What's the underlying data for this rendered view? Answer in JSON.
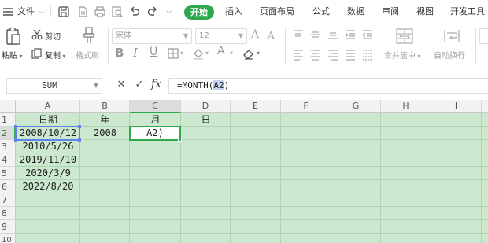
{
  "menu": {
    "file_label": "文件",
    "tabs": [
      "开始",
      "插入",
      "页面布局",
      "公式",
      "数据",
      "审阅",
      "视图",
      "开发工具"
    ],
    "active_tab": "开始"
  },
  "ribbon": {
    "paste_label": "粘贴",
    "cut_label": "剪切",
    "copy_label": "复制",
    "format_painter_label": "格式刷",
    "font_name": "宋体",
    "font_size": "12",
    "bold_label": "B",
    "italic_label": "I",
    "underline_label": "U",
    "merge_center_label": "合并居中",
    "auto_wrap_label": "自动换行"
  },
  "formula_bar": {
    "name_box": "SUM",
    "formula_prefix": "=MONTH(",
    "formula_ref": "A2",
    "formula_suffix": ")",
    "fx_label": "fx"
  },
  "sheet": {
    "columns": [
      "A",
      "B",
      "C",
      "D",
      "E",
      "F",
      "G",
      "H",
      "I"
    ],
    "rows": [
      "1",
      "2",
      "3",
      "4",
      "5",
      "6",
      "7",
      "8",
      "9",
      "10"
    ],
    "selected_column": "C",
    "selected_row": "2",
    "header_row": [
      "日期",
      "年",
      "月",
      "日"
    ],
    "dates": [
      "2008/10/12",
      "2010/5/26",
      "2019/11/10",
      "2020/3/9",
      "2022/8/20"
    ],
    "b2_value": "2008",
    "c2_editing": "A2)",
    "colors": {
      "grid_background": "#cce8cf",
      "active_tab": "#2ea84f",
      "reference_highlight": "#5d82e8"
    }
  }
}
